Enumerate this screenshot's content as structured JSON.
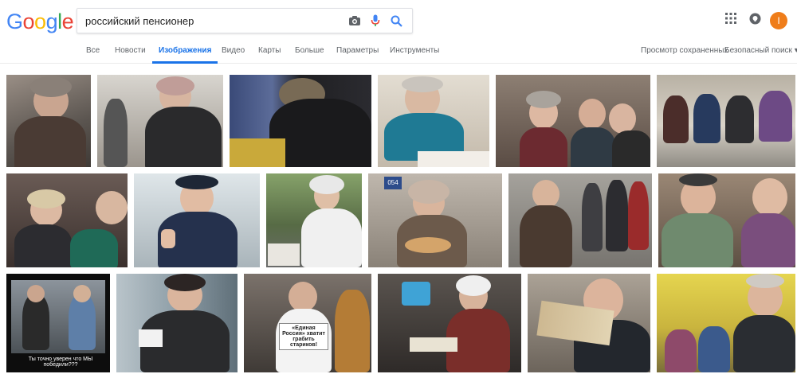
{
  "logo": {
    "letters": [
      "G",
      "o",
      "o",
      "g",
      "l",
      "e"
    ],
    "colors": [
      "#4285f4",
      "#ea4335",
      "#fbbc05",
      "#4285f4",
      "#34a853",
      "#ea4335"
    ]
  },
  "search": {
    "query": "российский пенсионер",
    "icons": [
      "camera-icon",
      "microphone-icon",
      "search-icon"
    ]
  },
  "account": {
    "avatar_letter": "I",
    "avatar_color": "#ef7d1a"
  },
  "tabs": [
    {
      "label": "Все"
    },
    {
      "label": "Новости"
    },
    {
      "label": "Изображения",
      "active": true
    },
    {
      "label": "Видео"
    },
    {
      "label": "Карты"
    },
    {
      "label": "Больше"
    },
    {
      "label": "Параметры"
    },
    {
      "label": "Инструменты"
    }
  ],
  "right_links": {
    "saved": "Просмотр сохраненных",
    "safe_search": "Безопасный поиск ▾"
  },
  "images": {
    "r2_caption": "",
    "r3_caption_1": "Ты точно уверен что МЫ победили???",
    "r3_sign": "«Единая Россия» хватит грабить стариков!"
  },
  "colors": {
    "accent": "#1a73e8",
    "tab_text": "#5f6368"
  }
}
